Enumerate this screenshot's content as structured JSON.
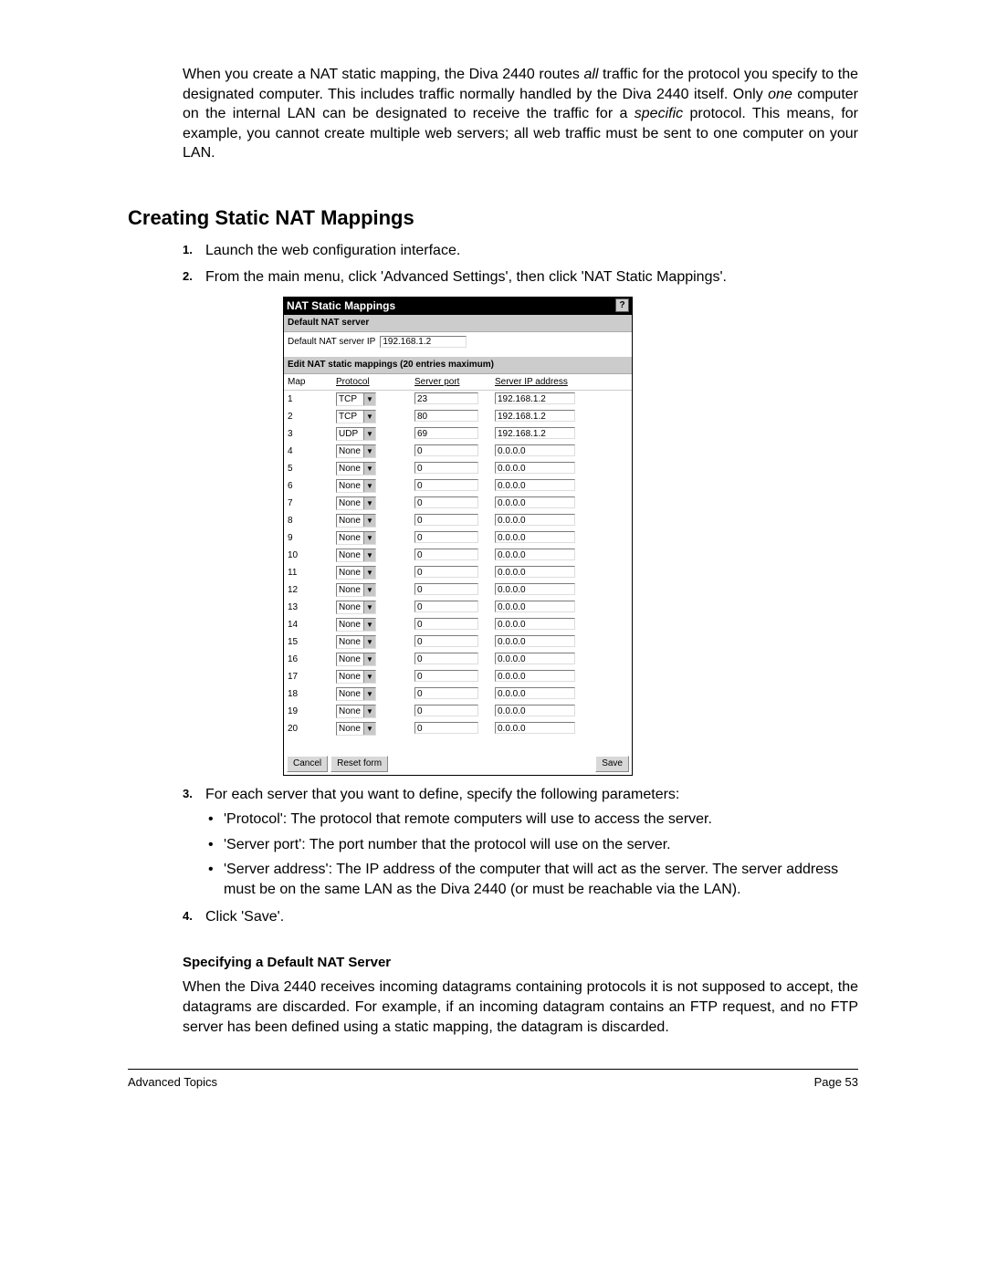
{
  "intro": {
    "p1_part1": "When you create a NAT static mapping, the Diva 2440 routes ",
    "p1_italic1": "all",
    "p1_part2": " traffic for the protocol you specify to the designated computer. This includes traffic normally handled by the Diva 2440 itself. Only ",
    "p1_italic2": "one",
    "p1_part3": " computer on the internal LAN can be designated to receive the traffic for a ",
    "p1_italic3": "specific ",
    "p1_part4": "protocol. This means, for example, you cannot create multiple web servers; all web traffic must be sent to one computer on your LAN."
  },
  "section_heading": "Creating Static NAT Mappings",
  "steps": {
    "s1": "Launch the web configuration interface.",
    "s2": "From the main menu, click 'Advanced Settings', then click 'NAT Static Mappings'.",
    "s3": "For each server that you want to define, specify the following parameters:",
    "b1": "'Protocol': The protocol that remote computers will use to access the server.",
    "b2": "'Server port': The port number that the protocol will use on the server.",
    "b3": "'Server address': The IP address of the computer that will act as the server. The server address must be on the same LAN as the Diva 2440 (or must be reachable via the LAN).",
    "s4": "Click 'Save'."
  },
  "screenshot": {
    "title": "NAT Static Mappings",
    "help": "?",
    "default_header": "Default NAT server",
    "default_label": "Default NAT server IP",
    "default_value": "192.168.1.2",
    "edit_header": "Edit NAT static mappings (20 entries maximum)",
    "cols": {
      "map": "Map",
      "protocol": "Protocol",
      "port": "Server port",
      "ip": "Server IP address"
    },
    "rows": [
      {
        "n": "1",
        "proto": "TCP",
        "port": "23",
        "ip": "192.168.1.2"
      },
      {
        "n": "2",
        "proto": "TCP",
        "port": "80",
        "ip": "192.168.1.2"
      },
      {
        "n": "3",
        "proto": "UDP",
        "port": "69",
        "ip": "192.168.1.2"
      },
      {
        "n": "4",
        "proto": "None",
        "port": "0",
        "ip": "0.0.0.0"
      },
      {
        "n": "5",
        "proto": "None",
        "port": "0",
        "ip": "0.0.0.0"
      },
      {
        "n": "6",
        "proto": "None",
        "port": "0",
        "ip": "0.0.0.0"
      },
      {
        "n": "7",
        "proto": "None",
        "port": "0",
        "ip": "0.0.0.0"
      },
      {
        "n": "8",
        "proto": "None",
        "port": "0",
        "ip": "0.0.0.0"
      },
      {
        "n": "9",
        "proto": "None",
        "port": "0",
        "ip": "0.0.0.0"
      },
      {
        "n": "10",
        "proto": "None",
        "port": "0",
        "ip": "0.0.0.0"
      },
      {
        "n": "11",
        "proto": "None",
        "port": "0",
        "ip": "0.0.0.0"
      },
      {
        "n": "12",
        "proto": "None",
        "port": "0",
        "ip": "0.0.0.0"
      },
      {
        "n": "13",
        "proto": "None",
        "port": "0",
        "ip": "0.0.0.0"
      },
      {
        "n": "14",
        "proto": "None",
        "port": "0",
        "ip": "0.0.0.0"
      },
      {
        "n": "15",
        "proto": "None",
        "port": "0",
        "ip": "0.0.0.0"
      },
      {
        "n": "16",
        "proto": "None",
        "port": "0",
        "ip": "0.0.0.0"
      },
      {
        "n": "17",
        "proto": "None",
        "port": "0",
        "ip": "0.0.0.0"
      },
      {
        "n": "18",
        "proto": "None",
        "port": "0",
        "ip": "0.0.0.0"
      },
      {
        "n": "19",
        "proto": "None",
        "port": "0",
        "ip": "0.0.0.0"
      },
      {
        "n": "20",
        "proto": "None",
        "port": "0",
        "ip": "0.0.0.0"
      }
    ],
    "buttons": {
      "cancel": "Cancel",
      "reset": "Reset form",
      "save": "Save"
    }
  },
  "subsection_heading": "Specifying a Default NAT Server",
  "subsection_para": "When the Diva 2440 receives incoming datagrams containing protocols it is not supposed to accept, the datagrams are discarded. For example, if an incoming datagram contains an FTP request, and no FTP server has been defined using a static mapping, the datagram is discarded.",
  "footer": {
    "left": "Advanced Topics",
    "right": "Page 53"
  }
}
